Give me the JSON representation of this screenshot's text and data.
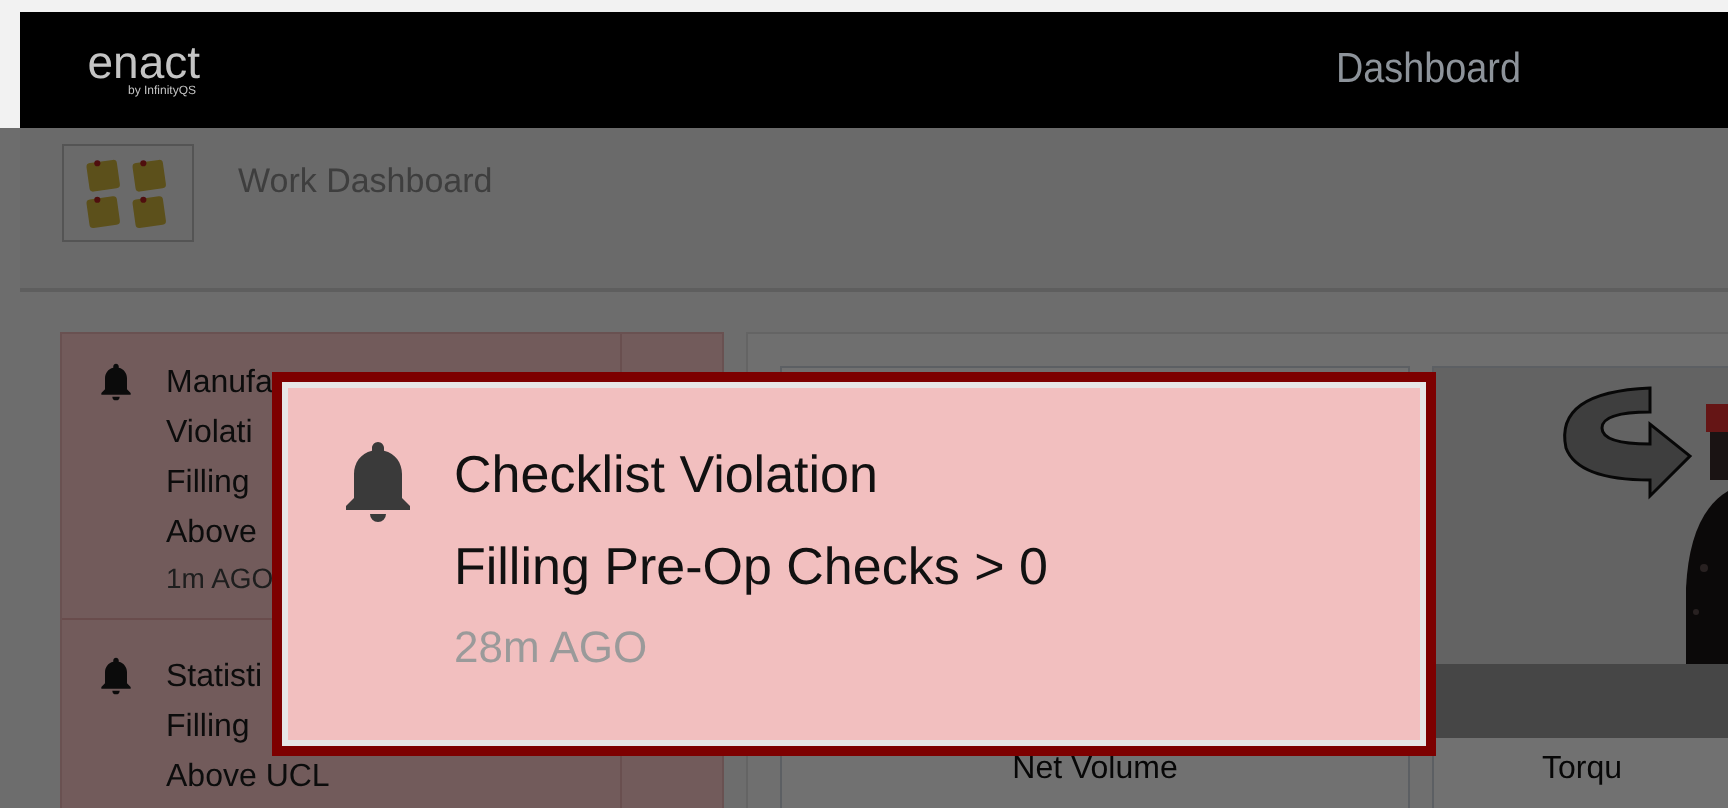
{
  "header": {
    "logo": "enact",
    "logo_sub": "by InfinityQS",
    "title": "Dashboard"
  },
  "subheader": {
    "title": "Work Dashboard"
  },
  "notifications": [
    {
      "lines": [
        "Manufa",
        "Violati",
        "Filling",
        "Above"
      ],
      "time": "1m AGO"
    },
    {
      "lines": [
        "Statisti",
        "Filling",
        "Above UCL"
      ]
    }
  ],
  "tiles": [
    {
      "kind": "blank",
      "label": "Net Volume"
    },
    {
      "kind": "picture",
      "label": "Torqu"
    }
  ],
  "popup": {
    "title": "Checklist Violation",
    "message": "Filling Pre-Op Checks > 0",
    "time": "28m AGO"
  }
}
